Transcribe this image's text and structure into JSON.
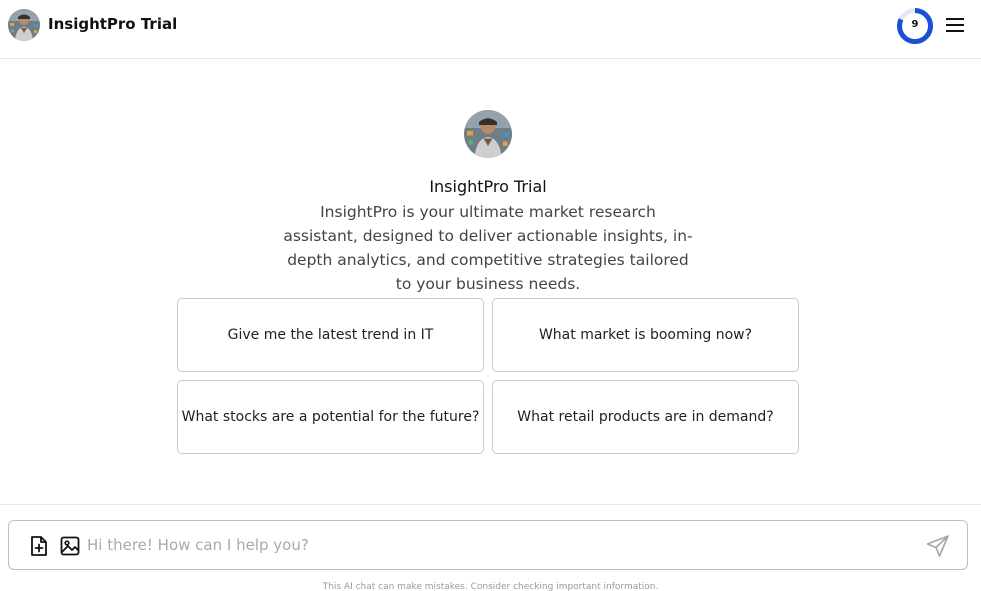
{
  "header": {
    "title": "InsightPro Trial",
    "credits_remaining": "9",
    "credits_fraction": 0.82,
    "accent_color": "#1a4fd6"
  },
  "icons": {
    "avatar": "bot-avatar-icon",
    "menu": "hamburger-menu-icon",
    "attach_file": "file-plus-icon",
    "attach_image": "image-icon",
    "send": "send-paper-plane-icon"
  },
  "hero": {
    "name": "InsightPro Trial",
    "description": "InsightPro is your ultimate market research assistant, designed to deliver actionable insights, in-depth analytics, and competitive strategies tailored to your business needs."
  },
  "suggestions": [
    "Give me the latest trend in IT",
    "What market is booming now?",
    "What stocks are a potential for the future?",
    "What retail products are in demand?"
  ],
  "composer": {
    "placeholder": "Hi there! How can I help you?",
    "value": ""
  },
  "footer": {
    "disclaimer": "This AI chat can make mistakes. Consider checking important information."
  }
}
